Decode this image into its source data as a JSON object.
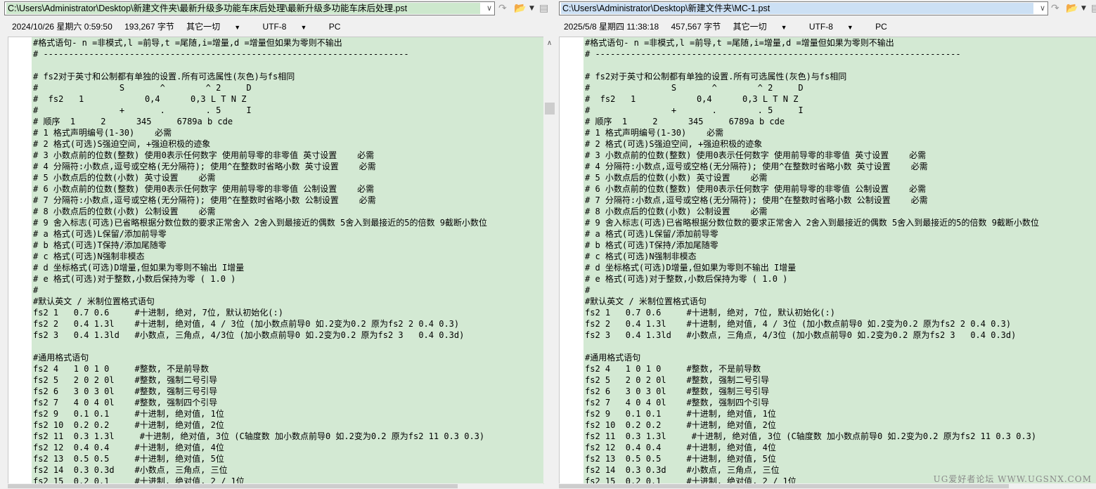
{
  "left": {
    "path": "C:\\Users\\Administrator\\Desktop\\新建文件夹\\最新升级多功能车床后处理\\最新升级多功能车床后处理.pst",
    "datetime": "2024/10/26 星期六 0:59:50",
    "size": "193,267 字节",
    "filter": "其它一切",
    "encoding": "UTF-8",
    "line_ending": "PC"
  },
  "right": {
    "path": "C:\\Users\\Administrator\\Desktop\\新建文件夹\\MC-1.pst",
    "datetime": "2025/5/8 星期四 11:38:18",
    "size": "457,567 字节",
    "filter": "其它一切",
    "encoding": "UTF-8",
    "line_ending": "PC"
  },
  "icons": {
    "dropdown": "chevron-down-icon",
    "next": "arrow-next-icon",
    "folder": "folder-open-icon",
    "save": "save-icon",
    "scroll_up": "chevron-up-icon"
  },
  "colors": {
    "match_background": "#d3e9d3",
    "left_path_background": "#cde8cd",
    "right_path_background": "#cce0f4"
  },
  "lines": [
    "#格式语句- n =非模式,l =前导,t =尾随,i=增量,d =增量但如果为零则不输出",
    "# ------------------------------------------------------------------------",
    "",
    "# fs2对于英寸和公制都有单独的设置.所有可选属性(灰色)与fs相同",
    "#                S       ^        ^ 2     D",
    "#  fs2   1            0,4      0,3 L T N Z",
    "#                +       .        . 5     I",
    "# 顺序  1     2      345     6789a b cde",
    "# 1 格式声明编号(1-30)    必需",
    "# 2 格式(可选)S强迫空间, +强迫积极的迹象",
    "# 3 小数点前的位数(整数) 使用0表示任何数字 使用前导零的非零值 英寸设置    必需",
    "# 4 分隔符:小数点,逗号或空格(无分隔符); 使用^在整数时省略小数 英寸设置    必需",
    "# 5 小数点后的位数(小数) 英寸设置    必需",
    "# 6 小数点前的位数(整数) 使用0表示任何数字 使用前导零的非零值 公制设置    必需",
    "# 7 分隔符:小数点,逗号或空格(无分隔符); 使用^在整数时省略小数 公制设置    必需",
    "# 8 小数点后的位数(小数) 公制设置    必需",
    "# 9 舍入标志(可选)已省略根据分数位数的要求正常舍入 2舍入到最接近的偶数 5舍入到最接近的5的倍数 9截断小数位",
    "# a 格式(可选)L保留/添加前导零",
    "# b 格式(可选)T保持/添加尾随零",
    "# c 格式(可选)N强制非模态",
    "# d 坐标格式(可选)D增量,但如果为零则不输出 I增量",
    "# e 格式(可选)对于整数,小数后保持为零 ( 1.0 )",
    "#",
    "#默认英文 / 米制位置格式语句",
    "fs2 1   0.7 0.6     #十进制, 绝对, 7位, 默认初始化(:)",
    "fs2 2   0.4 1.3l    #十进制, 绝对值, 4 / 3位 (加小数点前导0 如.2变为0.2 原为fs2 2 0.4 0.3)",
    "fs2 3   0.4 1.3ld   #小数点, 三角点, 4/3位 (加小数点前导0 如.2变为0.2 原为fs2 3   0.4 0.3d)",
    "",
    "#通用格式语句",
    "fs2 4   1 0 1 0     #整数, 不是前导数",
    "fs2 5   2 0 2 0l    #整数, 强制二号引导",
    "fs2 6   3 0 3 0l    #整数, 强制三号引导",
    "fs2 7   4 0 4 0l    #整数, 强制四个引导",
    "fs2 9   0.1 0.1     #十进制, 绝对值, 1位",
    "fs2 10  0.2 0.2     #十进制, 绝对值, 2位",
    "fs2 11  0.3 1.3l     #十进制, 绝对值, 3位 (C轴度数 加小数点前导0 如.2变为0.2 原为fs2 11 0.3 0.3)",
    "fs2 12  0.4 0.4     #十进制, 绝对值, 4位",
    "fs2 13  0.5 0.5     #十进制, 绝对值, 5位",
    "fs2 14  0.3 0.3d    #小数点, 三角点, 三位",
    "fs2 15  0.2 0.1     #十进制, 绝对值, 2 / 1位"
  ],
  "watermark": "UG爱好者论坛 WWW.UGSNX.COM"
}
